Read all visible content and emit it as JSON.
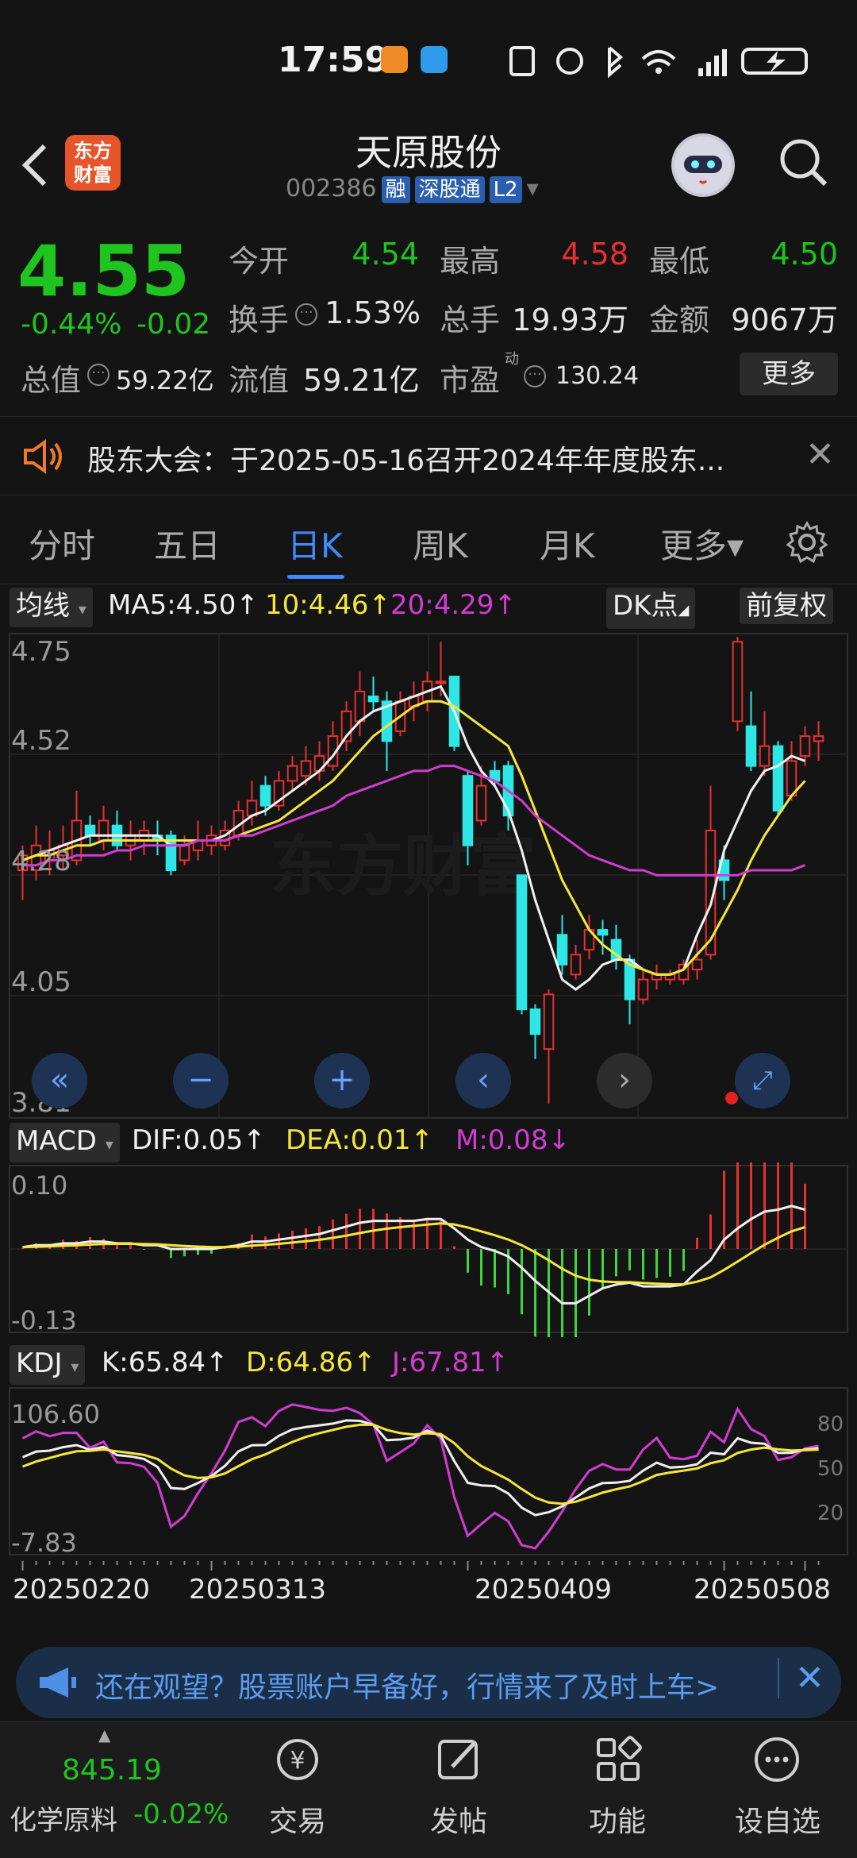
{
  "status": {
    "time": "17:59"
  },
  "header": {
    "logo_text_1": "东方",
    "logo_text_2": "财富",
    "title": "天原股份",
    "code": "002386",
    "tags": [
      "融",
      "深股通",
      "L2"
    ]
  },
  "quote": {
    "price": "4.55",
    "change_pct": "-0.44%",
    "change": "-0.02",
    "open_label": "今开",
    "open": "4.54",
    "high_label": "最高",
    "high": "4.58",
    "low_label": "最低",
    "low": "4.50",
    "turnover_label": "换手",
    "turnover": "1.53%",
    "volume_label": "总手",
    "volume": "19.93万",
    "amount_label": "金额",
    "amount": "9067万",
    "mktcap_label": "总值",
    "mktcap": "59.22亿",
    "float_label": "流值",
    "float": "59.21亿",
    "pe_label": "市盈",
    "pe_sup": "动",
    "pe": "130.24",
    "more": "更多",
    "colors": {
      "up": "#e83030",
      "down": "#1fc41f"
    }
  },
  "notice": {
    "text": "股东大会：于2025-05-16召开2024年年度股东..."
  },
  "tabs": [
    {
      "label": "分时"
    },
    {
      "label": "五日"
    },
    {
      "label": "日K"
    },
    {
      "label": "周K"
    },
    {
      "label": "月K"
    },
    {
      "label": "更多▾"
    }
  ],
  "kline": {
    "indicator": "均线",
    "dk": "DK点",
    "adjust": "前复权",
    "ma5": "MA5:4.50↑",
    "ma10": "10:4.46↑",
    "ma20": "20:4.29↑",
    "y_labels": [
      "4.75",
      "4.52",
      "4.28",
      "4.05",
      "3.81"
    ],
    "watermark": "东方财富"
  },
  "macd": {
    "indicator": "MACD",
    "dif": "DIF:0.05↑",
    "dea": "DEA:0.01↑",
    "m": "M:0.08↓",
    "y_labels": [
      "0.10",
      "-0.13"
    ]
  },
  "kdj": {
    "indicator": "KDJ",
    "k": "K:65.84↑",
    "d": "D:64.86↑",
    "j": "J:67.81↑",
    "y_labels": [
      "106.60",
      "-7.83"
    ],
    "right_labels": [
      "80",
      "50",
      "20"
    ]
  },
  "dates": [
    "20250220",
    "20250313",
    "20250409",
    "20250508"
  ],
  "chart_data": {
    "type": "candlestick",
    "ylim": [
      3.81,
      4.75
    ],
    "candles": [
      {
        "o": 4.28,
        "c": 4.31,
        "h": 4.33,
        "l": 4.22
      },
      {
        "o": 4.28,
        "c": 4.33,
        "h": 4.37,
        "l": 4.26
      },
      {
        "o": 4.3,
        "c": 4.32,
        "h": 4.36,
        "l": 4.27
      },
      {
        "o": 4.31,
        "c": 4.33,
        "h": 4.37,
        "l": 4.28
      },
      {
        "o": 4.3,
        "c": 4.38,
        "h": 4.44,
        "l": 4.29
      },
      {
        "o": 4.37,
        "c": 4.35,
        "h": 4.39,
        "l": 4.33
      },
      {
        "o": 4.34,
        "c": 4.38,
        "h": 4.41,
        "l": 4.32
      },
      {
        "o": 4.37,
        "c": 4.33,
        "h": 4.4,
        "l": 4.32
      },
      {
        "o": 4.33,
        "c": 4.35,
        "h": 4.38,
        "l": 4.3
      },
      {
        "o": 4.34,
        "c": 4.36,
        "h": 4.38,
        "l": 4.31
      },
      {
        "o": 4.35,
        "c": 4.34,
        "h": 4.38,
        "l": 4.31
      },
      {
        "o": 4.35,
        "c": 4.28,
        "h": 4.36,
        "l": 4.27
      },
      {
        "o": 4.3,
        "c": 4.33,
        "h": 4.35,
        "l": 4.29
      },
      {
        "o": 4.32,
        "c": 4.34,
        "h": 4.38,
        "l": 4.3
      },
      {
        "o": 4.33,
        "c": 4.35,
        "h": 4.37,
        "l": 4.31
      },
      {
        "o": 4.33,
        "c": 4.36,
        "h": 4.38,
        "l": 4.32
      },
      {
        "o": 4.35,
        "c": 4.4,
        "h": 4.42,
        "l": 4.34
      },
      {
        "o": 4.39,
        "c": 4.42,
        "h": 4.46,
        "l": 4.37
      },
      {
        "o": 4.45,
        "c": 4.41,
        "h": 4.47,
        "l": 4.39
      },
      {
        "o": 4.41,
        "c": 4.46,
        "h": 4.48,
        "l": 4.4
      },
      {
        "o": 4.46,
        "c": 4.49,
        "h": 4.51,
        "l": 4.44
      },
      {
        "o": 4.47,
        "c": 4.5,
        "h": 4.53,
        "l": 4.45
      },
      {
        "o": 4.48,
        "c": 4.51,
        "h": 4.54,
        "l": 4.46
      },
      {
        "o": 4.49,
        "c": 4.55,
        "h": 4.58,
        "l": 4.48
      },
      {
        "o": 4.54,
        "c": 4.6,
        "h": 4.62,
        "l": 4.52
      },
      {
        "o": 4.58,
        "c": 4.64,
        "h": 4.68,
        "l": 4.55
      },
      {
        "o": 4.63,
        "c": 4.62,
        "h": 4.67,
        "l": 4.6
      },
      {
        "o": 4.62,
        "c": 4.54,
        "h": 4.64,
        "l": 4.48
      },
      {
        "o": 4.56,
        "c": 4.62,
        "h": 4.64,
        "l": 4.55
      },
      {
        "o": 4.61,
        "c": 4.63,
        "h": 4.66,
        "l": 4.58
      },
      {
        "o": 4.62,
        "c": 4.66,
        "h": 4.68,
        "l": 4.6
      },
      {
        "o": 4.66,
        "c": 4.66,
        "h": 4.74,
        "l": 4.63
      },
      {
        "o": 4.67,
        "c": 4.53,
        "h": 4.67,
        "l": 4.52
      },
      {
        "o": 4.47,
        "c": 4.33,
        "h": 4.48,
        "l": 4.29
      },
      {
        "o": 4.38,
        "c": 4.45,
        "h": 4.49,
        "l": 4.37
      },
      {
        "o": 4.48,
        "c": 4.46,
        "h": 4.5,
        "l": 4.45
      },
      {
        "o": 4.49,
        "c": 4.39,
        "h": 4.5,
        "l": 4.36
      },
      {
        "o": 4.27,
        "c": 4.0,
        "h": 4.27,
        "l": 3.99
      },
      {
        "o": 4.0,
        "c": 3.95,
        "h": 4.01,
        "l": 3.9
      },
      {
        "o": 3.92,
        "c": 4.03,
        "h": 4.04,
        "l": 3.81
      },
      {
        "o": 4.15,
        "c": 4.09,
        "h": 4.19,
        "l": 4.07
      },
      {
        "o": 4.07,
        "c": 4.11,
        "h": 4.13,
        "l": 4.06
      },
      {
        "o": 4.12,
        "c": 4.16,
        "h": 4.19,
        "l": 4.1
      },
      {
        "o": 4.16,
        "c": 4.15,
        "h": 4.18,
        "l": 4.11
      },
      {
        "o": 4.14,
        "c": 4.1,
        "h": 4.17,
        "l": 4.08
      },
      {
        "o": 4.1,
        "c": 4.02,
        "h": 4.11,
        "l": 3.97
      },
      {
        "o": 4.02,
        "c": 4.06,
        "h": 4.08,
        "l": 4.01
      },
      {
        "o": 4.06,
        "c": 4.07,
        "h": 4.09,
        "l": 4.04
      },
      {
        "o": 4.06,
        "c": 4.07,
        "h": 4.08,
        "l": 4.05
      },
      {
        "o": 4.06,
        "c": 4.09,
        "h": 4.1,
        "l": 4.05
      },
      {
        "o": 4.08,
        "c": 4.1,
        "h": 4.14,
        "l": 4.06
      },
      {
        "o": 4.11,
        "c": 4.36,
        "h": 4.45,
        "l": 4.1
      },
      {
        "o": 4.3,
        "c": 4.26,
        "h": 4.33,
        "l": 4.22
      },
      {
        "o": 4.58,
        "c": 4.74,
        "h": 4.75,
        "l": 4.56
      },
      {
        "o": 4.57,
        "c": 4.49,
        "h": 4.64,
        "l": 4.48
      },
      {
        "o": 4.49,
        "c": 4.53,
        "h": 4.6,
        "l": 4.47
      },
      {
        "o": 4.53,
        "c": 4.4,
        "h": 4.54,
        "l": 4.39
      },
      {
        "o": 4.43,
        "c": 4.5,
        "h": 4.54,
        "l": 4.42
      },
      {
        "o": 4.51,
        "c": 4.55,
        "h": 4.57,
        "l": 4.49
      },
      {
        "o": 4.54,
        "c": 4.55,
        "h": 4.58,
        "l": 4.5
      }
    ],
    "ma5": [
      4.3,
      4.31,
      4.32,
      4.33,
      4.34,
      4.35,
      4.35,
      4.35,
      4.35,
      4.35,
      4.35,
      4.33,
      4.33,
      4.34,
      4.34,
      4.35,
      4.37,
      4.39,
      4.4,
      4.42,
      4.44,
      4.46,
      4.48,
      4.51,
      4.55,
      4.58,
      4.6,
      4.61,
      4.62,
      4.63,
      4.64,
      4.65,
      4.6,
      4.53,
      4.48,
      4.45,
      4.4,
      4.32,
      4.22,
      4.14,
      4.06,
      4.04,
      4.06,
      4.09,
      4.1,
      4.1,
      4.08,
      4.07,
      4.07,
      4.08,
      4.15,
      4.21,
      4.32,
      4.38,
      4.44,
      4.48,
      4.49,
      4.51,
      4.5
    ],
    "ma10": [
      4.3,
      4.31,
      4.31,
      4.32,
      4.33,
      4.33,
      4.34,
      4.34,
      4.34,
      4.34,
      4.34,
      4.34,
      4.34,
      4.34,
      4.34,
      4.34,
      4.35,
      4.36,
      4.37,
      4.38,
      4.4,
      4.42,
      4.44,
      4.46,
      4.49,
      4.52,
      4.55,
      4.57,
      4.59,
      4.61,
      4.62,
      4.62,
      4.61,
      4.59,
      4.57,
      4.55,
      4.53,
      4.47,
      4.4,
      4.33,
      4.26,
      4.21,
      4.16,
      4.13,
      4.11,
      4.09,
      4.08,
      4.07,
      4.07,
      4.08,
      4.11,
      4.14,
      4.19,
      4.24,
      4.3,
      4.35,
      4.39,
      4.43,
      4.46
    ],
    "ma20": [
      4.29,
      4.29,
      4.3,
      4.3,
      4.31,
      4.31,
      4.31,
      4.32,
      4.32,
      4.33,
      4.33,
      4.33,
      4.33,
      4.34,
      4.34,
      4.34,
      4.35,
      4.35,
      4.36,
      4.37,
      4.38,
      4.39,
      4.4,
      4.41,
      4.43,
      4.44,
      4.45,
      4.46,
      4.47,
      4.48,
      4.48,
      4.49,
      4.49,
      4.48,
      4.47,
      4.46,
      4.44,
      4.42,
      4.39,
      4.37,
      4.35,
      4.33,
      4.31,
      4.3,
      4.29,
      4.28,
      4.28,
      4.27,
      4.27,
      4.27,
      4.27,
      4.27,
      4.27,
      4.27,
      4.28,
      4.28,
      4.28,
      4.28,
      4.29
    ]
  }
}
